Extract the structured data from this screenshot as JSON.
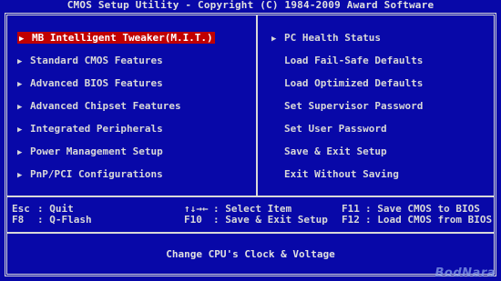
{
  "title": "CMOS Setup Utility - Copyright (C) 1984-2009 Award Software",
  "arrow_glyph": "▶",
  "left_menu": [
    {
      "label": "MB Intelligent Tweaker(M.I.T.)"
    },
    {
      "label": "Standard CMOS Features"
    },
    {
      "label": "Advanced BIOS Features"
    },
    {
      "label": "Advanced Chipset Features"
    },
    {
      "label": "Integrated Peripherals"
    },
    {
      "label": "Power Management Setup"
    },
    {
      "label": "PnP/PCI Configurations"
    }
  ],
  "right_menu": [
    {
      "label": "PC Health Status"
    },
    {
      "label": "Load Fail-Safe Defaults"
    },
    {
      "label": "Load Optimized Defaults"
    },
    {
      "label": "Set Supervisor Password"
    },
    {
      "label": "Set User Password"
    },
    {
      "label": "Save & Exit Setup"
    },
    {
      "label": "Exit Without Saving"
    }
  ],
  "keys": {
    "esc_key": "Esc",
    "esc_desc": ": Quit",
    "f8_key": "F8",
    "f8_desc": ": Q-Flash",
    "arrows_key": "↑↓→←",
    "arrows_desc": ": Select Item",
    "f10_key": "F10",
    "f10_desc": ": Save & Exit Setup",
    "f11_key": "F11",
    "f11_desc": ": Save CMOS to BIOS",
    "f12_key": "F12",
    "f12_desc": ": Load CMOS from BIOS"
  },
  "help_text": "Change CPU's Clock & Voltage",
  "watermark": "BodNara",
  "colors": {
    "background": "#0808a8",
    "text": "#d8d8d8",
    "selected_bg": "#c00000"
  }
}
